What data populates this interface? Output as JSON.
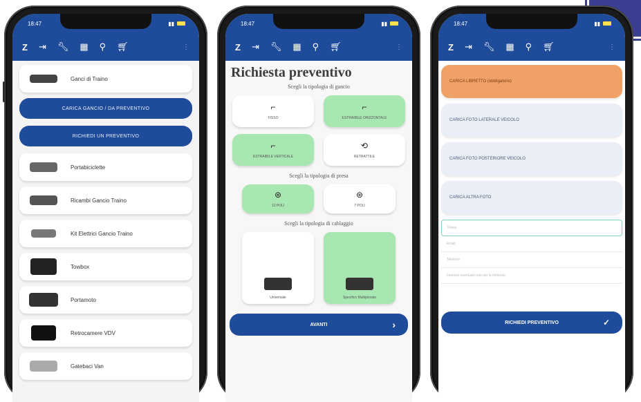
{
  "brand_color": "#1e4c9a",
  "accent_selected": "#a9e7b2",
  "accent_orange": "#f0a266",
  "status": {
    "time": "18:47"
  },
  "toolbar_icons": [
    "logo-z-icon",
    "login-icon",
    "wrench-icon",
    "grid-icon",
    "tow-icon",
    "cart-icon"
  ],
  "phone1": {
    "items": [
      {
        "label": "Ganci di Traino"
      },
      {
        "label": "Portabiciclette"
      },
      {
        "label": "Ricambi Gancio Traino"
      },
      {
        "label": "Kit Elettrici Gancio Traino"
      },
      {
        "label": "Towbox"
      },
      {
        "label": "Portamoto"
      },
      {
        "label": "Retrocamere VDV"
      },
      {
        "label": "Gatebaci Van"
      }
    ],
    "btn_upload": "CARICA GANCIO / DA PREVENTIVO",
    "btn_request": "RICHIEDI UN PREVENTIVO"
  },
  "phone2": {
    "title": "Richiesta preventivo",
    "sub_gancio": "Scegli la tipologia di gancio",
    "gancio_options": [
      {
        "label": "FISSO",
        "selected": false
      },
      {
        "label": "ESTRAIBILE ORIZZONTALE",
        "selected": true
      },
      {
        "label": "ESTRAIBILE VERTICALE",
        "selected": true
      },
      {
        "label": "RETRATTILE",
        "selected": false
      }
    ],
    "sub_presa": "Scegli la tipologia di presa",
    "presa_options": [
      {
        "label": "13 POLI",
        "selected": true
      },
      {
        "label": "7 POLI",
        "selected": false
      }
    ],
    "sub_cablaggio": "Scegli la tipologia di cablaggio",
    "cablaggio_options": [
      {
        "label": "Universale",
        "selected": false
      },
      {
        "label": "Specifico Multiplexato",
        "selected": true
      }
    ],
    "next_label": "AVANTI"
  },
  "phone3": {
    "uploads": [
      {
        "label": "CARICA LIBRETTO (obbligatorio)",
        "primary": true
      },
      {
        "label": "CARICA FOTO LATERALE VEICOLO",
        "primary": false
      },
      {
        "label": "CARICA FOTO POSTERIORE VEICOLO",
        "primary": false
      },
      {
        "label": "CARICA ALTRA FOTO",
        "primary": false
      }
    ],
    "fields": [
      {
        "placeholder": "Nome"
      },
      {
        "placeholder": "Email"
      },
      {
        "placeholder": "Telefono"
      },
      {
        "placeholder": "Inserisci eventuali note per la richiesta"
      }
    ],
    "send_label": "RICHIEDI PREVENTIVO"
  }
}
